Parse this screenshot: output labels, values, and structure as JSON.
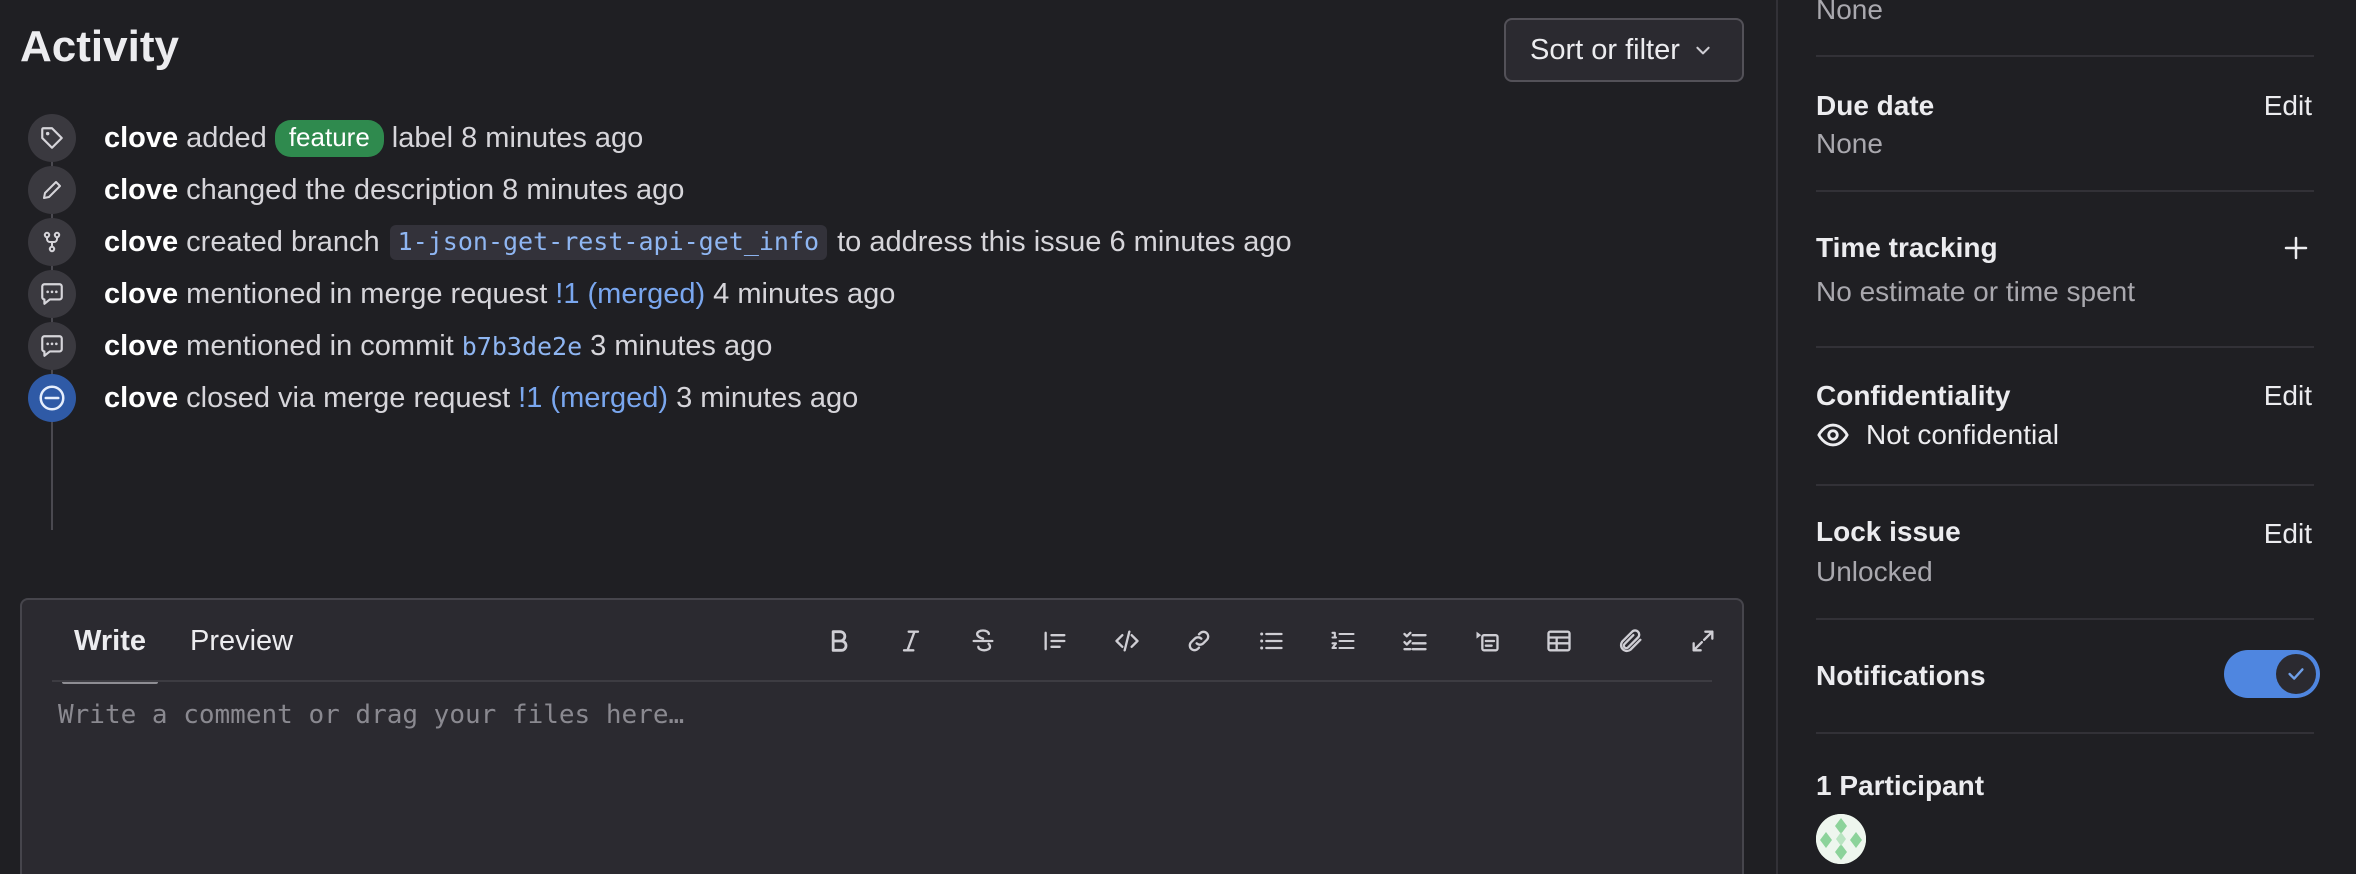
{
  "activity": {
    "title": "Activity",
    "sort_filter_label": "Sort or filter"
  },
  "events": [
    {
      "icon": "tag-icon",
      "author": "clove",
      "parts": [
        "added",
        "feature",
        "label 8 minutes ago"
      ]
    },
    {
      "icon": "pencil-icon",
      "author": "clove",
      "parts": [
        "changed the description 8 minutes ago"
      ]
    },
    {
      "icon": "branch-icon",
      "author": "clove",
      "parts": [
        "created branch",
        "1-json-get-rest-api-get_info",
        "to address this issue 6 minutes ago"
      ]
    },
    {
      "icon": "comment-icon",
      "author": "clove",
      "parts": [
        "mentioned in merge request",
        "!1 (merged)",
        "4 minutes ago"
      ]
    },
    {
      "icon": "comment-icon",
      "author": "clove",
      "parts": [
        "mentioned in commit",
        "b7b3de2e",
        "3 minutes ago"
      ]
    },
    {
      "icon": "closed-icon",
      "author": "clove",
      "parts": [
        "closed via merge request",
        "!1 (merged)",
        "3 minutes ago"
      ]
    }
  ],
  "editor": {
    "tabs": [
      "Write",
      "Preview"
    ],
    "active_tab": "Write",
    "placeholder": "Write a comment or drag your files here…",
    "value": "",
    "toolbar": [
      "bold-icon",
      "italic-icon",
      "strikethrough-icon",
      "quote-icon",
      "code-icon",
      "link-icon",
      "bullet-list-icon",
      "numbered-list-icon",
      "task-list-icon",
      "collapsible-section-icon",
      "table-icon",
      "attach-icon",
      "fullscreen-icon"
    ]
  },
  "sidebar": {
    "milestone_value": "None",
    "due_date": {
      "title": "Due date",
      "value": "None",
      "edit": "Edit"
    },
    "time_tracking": {
      "title": "Time tracking",
      "value": "No estimate or time spent"
    },
    "confidentiality": {
      "title": "Confidentiality",
      "value": "Not confidential",
      "edit": "Edit"
    },
    "lock_issue": {
      "title": "Lock issue",
      "value": "Unlocked",
      "edit": "Edit"
    },
    "notifications": {
      "title": "Notifications",
      "enabled": true
    },
    "participants": {
      "title": "1 Participant"
    }
  },
  "colors": {
    "background": "#1f1f23",
    "label_feature": "#2f8a4e",
    "link": "#7aa7ef",
    "toggle_on": "#4f86e0",
    "closed_icon": "#2f5aa6"
  }
}
